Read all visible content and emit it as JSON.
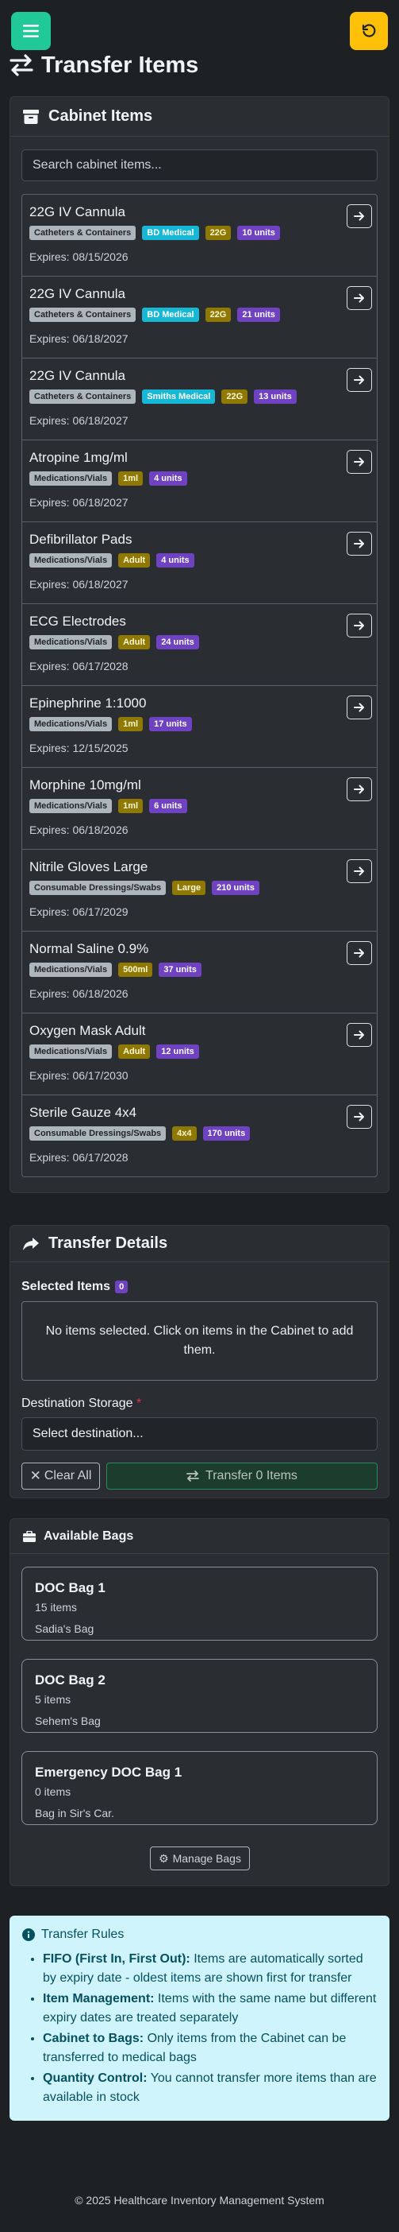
{
  "header": {
    "title": "Transfer Items"
  },
  "cabinet": {
    "title": "Cabinet Items",
    "search_placeholder": "Search cabinet items...",
    "items": [
      {
        "name": "22G IV Cannula",
        "category": "Catheters & Containers",
        "brand": "BD Medical",
        "size": "22G",
        "units": "10 units",
        "expires": "Expires: 08/15/2026"
      },
      {
        "name": "22G IV Cannula",
        "category": "Catheters & Containers",
        "brand": "BD Medical",
        "size": "22G",
        "units": "21 units",
        "expires": "Expires: 06/18/2027"
      },
      {
        "name": "22G IV Cannula",
        "category": "Catheters & Containers",
        "brand": "Smiths Medical",
        "size": "22G",
        "units": "13 units",
        "expires": "Expires: 06/18/2027"
      },
      {
        "name": "Atropine 1mg/ml",
        "category": "Medications/Vials",
        "size": "1ml",
        "units": "4 units",
        "expires": "Expires: 06/18/2027"
      },
      {
        "name": "Defibrillator Pads",
        "category": "Medications/Vials",
        "size": "Adult",
        "units": "4 units",
        "expires": "Expires: 06/18/2027"
      },
      {
        "name": "ECG Electrodes",
        "category": "Medications/Vials",
        "size": "Adult",
        "units": "24 units",
        "expires": "Expires: 06/17/2028"
      },
      {
        "name": "Epinephrine 1:1000",
        "category": "Medications/Vials",
        "size": "1ml",
        "units": "17 units",
        "expires": "Expires: 12/15/2025"
      },
      {
        "name": "Morphine 10mg/ml",
        "category": "Medications/Vials",
        "size": "1ml",
        "units": "6 units",
        "expires": "Expires: 06/18/2026"
      },
      {
        "name": "Nitrile Gloves Large",
        "category": "Consumable Dressings/Swabs",
        "size": "Large",
        "units": "210 units",
        "expires": "Expires: 06/17/2029"
      },
      {
        "name": "Normal Saline 0.9%",
        "category": "Medications/Vials",
        "size": "500ml",
        "units": "37 units",
        "expires": "Expires: 06/18/2026"
      },
      {
        "name": "Oxygen Mask Adult",
        "category": "Medications/Vials",
        "size": "Adult",
        "units": "12 units",
        "expires": "Expires: 06/17/2030"
      },
      {
        "name": "Sterile Gauze 4x4",
        "category": "Consumable Dressings/Swabs",
        "size": "4x4",
        "units": "170 units",
        "expires": "Expires: 06/17/2028"
      }
    ]
  },
  "transfer": {
    "title": "Transfer Details",
    "selected_label": "Selected Items",
    "selected_count": "0",
    "empty_text": "No items selected. Click on items in the Cabinet to add them.",
    "destination_label": "Destination Storage",
    "required_mark": "*",
    "destination_value": "Select destination...",
    "clear_label": "Clear All",
    "transfer_label": "Transfer 0 Items"
  },
  "bags": {
    "title": "Available Bags",
    "list": [
      {
        "name": "DOC Bag 1",
        "count": "15 items",
        "owner": "Sadia's Bag"
      },
      {
        "name": "DOC Bag 2",
        "count": "5 items",
        "owner": "Sehem's Bag"
      },
      {
        "name": "Emergency DOC Bag 1",
        "count": "0 items",
        "owner": "Bag in Sir's Car."
      }
    ],
    "manage_label": "Manage Bags"
  },
  "rules": {
    "title": "Transfer Rules",
    "items": [
      {
        "label": "FIFO (First In, First Out):",
        "text": " Items are automatically sorted by expiry date - oldest items are shown first for transfer"
      },
      {
        "label": "Item Management:",
        "text": " Items with the same name but different expiry dates are treated separately"
      },
      {
        "label": "Cabinet to Bags:",
        "text": " Only items from the Cabinet can be transferred to medical bags"
      },
      {
        "label": "Quantity Control:",
        "text": " You cannot transfer more items than are available in stock"
      }
    ]
  },
  "footer": {
    "text": "© 2025 Healthcare Inventory Management System"
  },
  "colors": {
    "accent_teal": "#20c997",
    "accent_yellow": "#ffc107",
    "badge_purple": "#6f42c1",
    "badge_cyan": "#17b8d6",
    "badge_olive": "#8f7900",
    "info_bg": "#cff4fc"
  },
  "icons": {
    "menu": "hamburger-icon",
    "undo": "undo-icon",
    "title": "exchange-arrows-icon",
    "cabinet": "archive-box-icon",
    "transfer": "share-arrow-icon",
    "bags": "briefcase-icon",
    "go": "arrow-right-icon",
    "info": "info-circle-icon",
    "gear": "gear-icon"
  }
}
